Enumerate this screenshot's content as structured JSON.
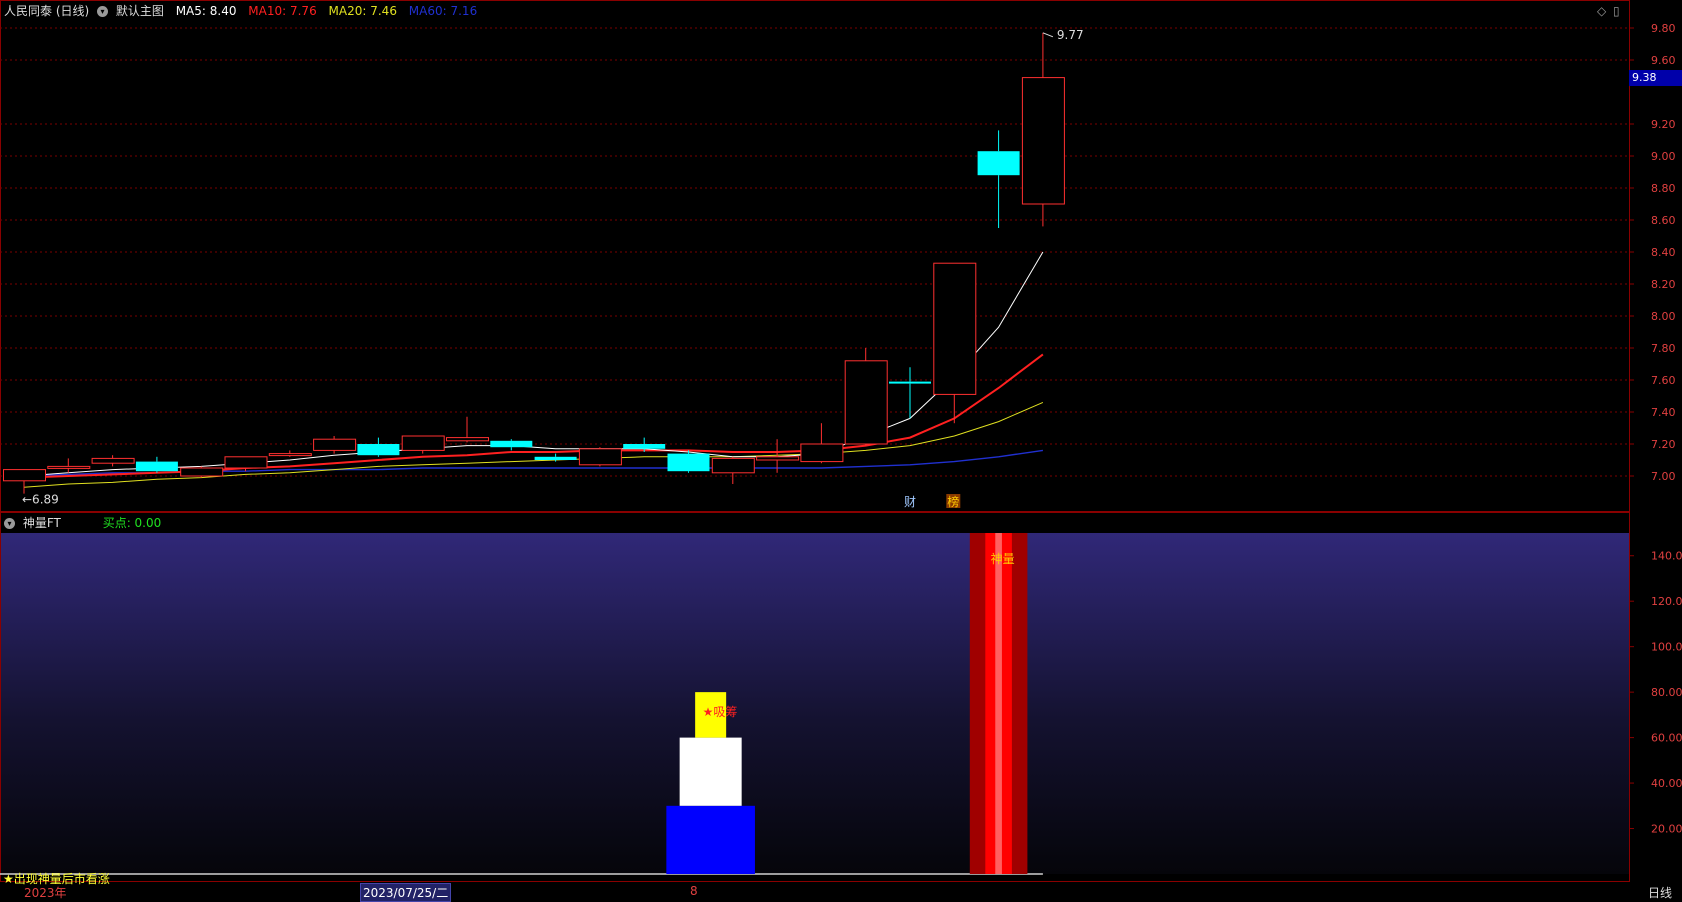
{
  "main_panel": {
    "stock_name": "人民同泰 (日线)",
    "template": "默认主图",
    "ma5_label": "MA5: 8.40",
    "ma10_label": "MA10: 7.76",
    "ma20_label": "MA20: 7.46",
    "ma60_label": "MA60: 7.16",
    "high_label": "9.77",
    "low_label": "←6.89",
    "current_price": "9.38",
    "markers": [
      "财",
      "榜"
    ],
    "colors": {
      "ma5": "#ffffff",
      "ma10": "#ff2020",
      "ma20": "#e0e020",
      "ma60": "#2030d0",
      "up": "#ff3030",
      "down": "#00ffff"
    }
  },
  "sub_panel": {
    "indicator": "神量FT",
    "buy_point": "买点: 0.00",
    "label_xichou": "★吸筹",
    "label_shenliang": "神量",
    "note": "★出现神量后市看涨"
  },
  "date_bar": {
    "year": "2023年",
    "cursor_date": "2023/07/25/二",
    "mark": "8",
    "period": "日线"
  },
  "chart_data": [
    {
      "type": "candlestick",
      "title": "人民同泰 (日线)",
      "ylim": [
        6.85,
        9.85
      ],
      "y_ticks": [
        "9.80",
        "9.60",
        "9.38",
        "9.20",
        "9.00",
        "8.80",
        "8.60",
        "8.40",
        "8.20",
        "8.00",
        "7.80",
        "7.60",
        "7.40",
        "7.20",
        "7.00"
      ],
      "candles": [
        {
          "o": 6.97,
          "c": 7.04,
          "h": 7.04,
          "l": 6.89
        },
        {
          "o": 7.05,
          "c": 7.06,
          "h": 7.11,
          "l": 7.02
        },
        {
          "o": 7.08,
          "c": 7.11,
          "h": 7.13,
          "l": 7.06
        },
        {
          "o": 7.09,
          "c": 7.03,
          "h": 7.12,
          "l": 7.02
        },
        {
          "o": 7.0,
          "c": 7.05,
          "h": 7.06,
          "l": 6.99
        },
        {
          "o": 7.05,
          "c": 7.12,
          "h": 7.12,
          "l": 7.03
        },
        {
          "o": 7.14,
          "c": 7.14,
          "h": 7.16,
          "l": 7.12
        },
        {
          "o": 7.16,
          "c": 7.23,
          "h": 7.25,
          "l": 7.14
        },
        {
          "o": 7.2,
          "c": 7.13,
          "h": 7.24,
          "l": 7.12
        },
        {
          "o": 7.16,
          "c": 7.25,
          "h": 7.25,
          "l": 7.14
        },
        {
          "o": 7.22,
          "c": 7.24,
          "h": 7.37,
          "l": 7.21
        },
        {
          "o": 7.22,
          "c": 7.18,
          "h": 7.23,
          "l": 7.16
        },
        {
          "o": 7.12,
          "c": 7.1,
          "h": 7.14,
          "l": 7.09
        },
        {
          "o": 7.07,
          "c": 7.17,
          "h": 7.18,
          "l": 7.06
        },
        {
          "o": 7.2,
          "c": 7.17,
          "h": 7.24,
          "l": 7.15
        },
        {
          "o": 7.14,
          "c": 7.03,
          "h": 7.16,
          "l": 7.02
        },
        {
          "o": 7.02,
          "c": 7.11,
          "h": 7.12,
          "l": 6.95
        },
        {
          "o": 7.1,
          "c": 7.12,
          "h": 7.23,
          "l": 7.02
        },
        {
          "o": 7.09,
          "c": 7.2,
          "h": 7.33,
          "l": 7.08
        },
        {
          "o": 7.2,
          "c": 7.72,
          "h": 7.8,
          "l": 7.19
        },
        {
          "o": 7.59,
          "c": 7.58,
          "h": 7.68,
          "l": 7.36
        },
        {
          "o": 7.51,
          "c": 8.33,
          "h": 8.33,
          "l": 7.33
        },
        {
          "o": 9.03,
          "c": 8.88,
          "h": 9.16,
          "l": 8.55
        },
        {
          "o": 8.7,
          "c": 9.49,
          "h": 9.77,
          "l": 8.56
        }
      ],
      "ma5": [
        7.0,
        7.02,
        7.04,
        7.05,
        7.06,
        7.08,
        7.1,
        7.13,
        7.15,
        7.17,
        7.19,
        7.19,
        7.17,
        7.17,
        7.17,
        7.15,
        7.12,
        7.12,
        7.14,
        7.25,
        7.36,
        7.62,
        7.93,
        8.4
      ],
      "ma10": [
        6.99,
        7.0,
        7.01,
        7.02,
        7.03,
        7.05,
        7.06,
        7.08,
        7.1,
        7.12,
        7.13,
        7.15,
        7.15,
        7.16,
        7.16,
        7.16,
        7.15,
        7.15,
        7.16,
        7.19,
        7.24,
        7.36,
        7.55,
        7.76
      ],
      "ma20": [
        6.93,
        6.95,
        6.96,
        6.98,
        6.99,
        7.01,
        7.02,
        7.04,
        7.06,
        7.07,
        7.08,
        7.09,
        7.1,
        7.11,
        7.12,
        7.12,
        7.12,
        7.13,
        7.14,
        7.16,
        7.19,
        7.25,
        7.34,
        7.46
      ],
      "ma60": [
        7.0,
        7.01,
        7.02,
        7.02,
        7.03,
        7.03,
        7.04,
        7.04,
        7.04,
        7.05,
        7.05,
        7.05,
        7.05,
        7.05,
        7.05,
        7.05,
        7.05,
        7.05,
        7.05,
        7.06,
        7.07,
        7.09,
        7.12,
        7.16
      ]
    },
    {
      "type": "bar",
      "title": "神量FT",
      "ylim": [
        0,
        150
      ],
      "y_ticks": [
        "140.00",
        "120.00",
        "100.00",
        "80.00",
        "60.00",
        "40.00",
        "20.00"
      ],
      "bars": [
        {
          "index": 15.5,
          "from": 0,
          "to": 30,
          "color": "#0000ff",
          "width": 2.0
        },
        {
          "index": 15.5,
          "from": 30,
          "to": 60,
          "color": "#ffffff",
          "width": 1.4
        },
        {
          "index": 15.5,
          "from": 60,
          "to": 80,
          "color": "#ffff00",
          "width": 0.7
        },
        {
          "index": 22.0,
          "from": 0,
          "to": 150,
          "color": "#a00000",
          "width": 1.3
        },
        {
          "index": 22.0,
          "from": 0,
          "to": 150,
          "color": "#ff0000",
          "width": 0.6
        },
        {
          "index": 22.0,
          "from": 0,
          "to": 150,
          "color": "#ff6060",
          "width": 0.15
        }
      ]
    }
  ]
}
